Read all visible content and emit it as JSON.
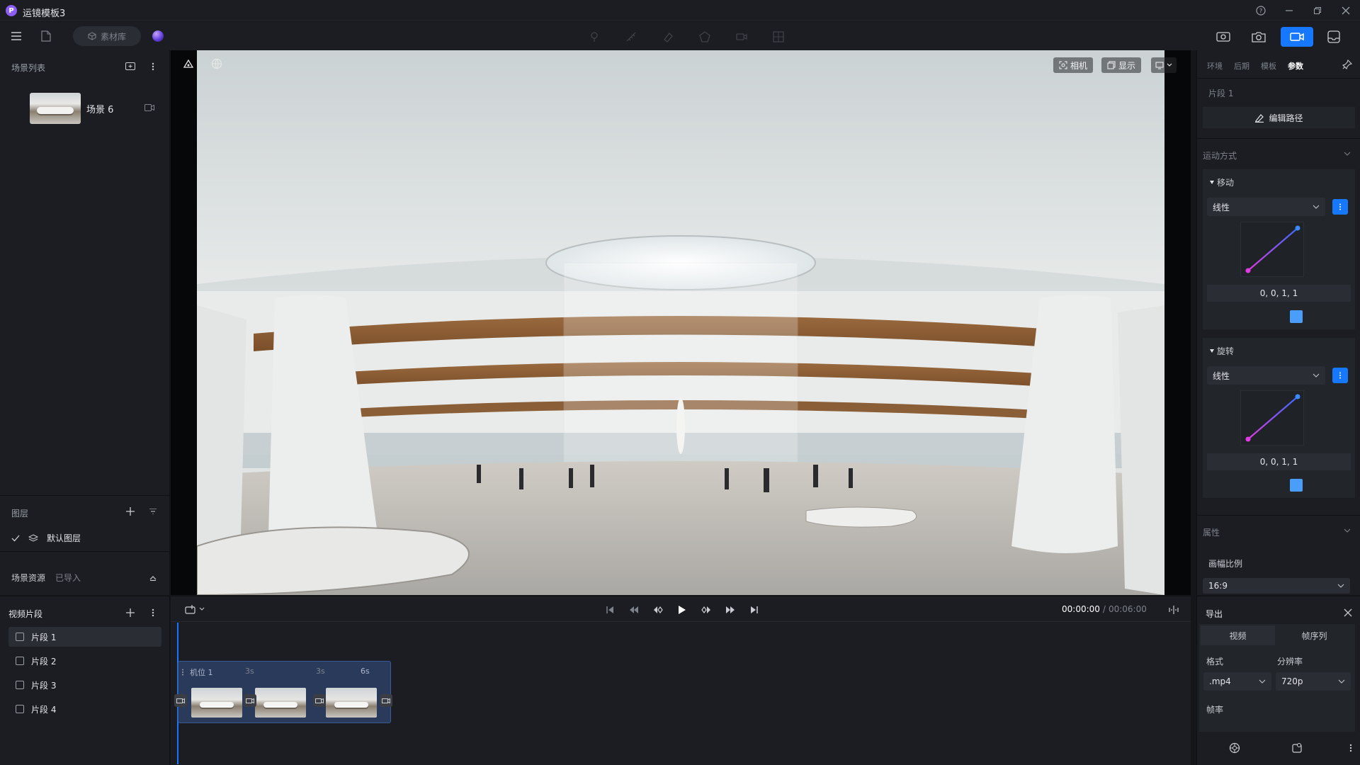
{
  "window": {
    "title": "运镜模板3",
    "logo_letter": "P",
    "controls": [
      "help-icon",
      "minimize-icon",
      "restore-icon",
      "close-icon"
    ]
  },
  "toolbar": {
    "material_library": "素材库",
    "right_tools": [
      "panorama-icon",
      "photo-icon",
      "video-camera-icon",
      "output-icon"
    ],
    "accent": "#1677ff"
  },
  "scene_list": {
    "title": "场景列表",
    "items": [
      {
        "name": "场景 6"
      }
    ]
  },
  "layers": {
    "title": "图层",
    "items": [
      {
        "name": "默认图层"
      }
    ]
  },
  "scene_assets": {
    "title": "场景资源",
    "status": "已导入"
  },
  "viewport": {
    "camera_label": "相机",
    "display_label": "显示"
  },
  "right_panel": {
    "tabs": [
      "环境",
      "后期",
      "模板",
      "参数"
    ],
    "active_tab": "参数",
    "segment_title": "片段 1",
    "edit_path": "编辑路径",
    "motion_mode": "运动方式",
    "move": {
      "title": "移动",
      "curve": "线性",
      "value": "0, 0, 1, 1"
    },
    "rotate": {
      "title": "旋转",
      "curve": "线性",
      "value": "0, 0, 1, 1"
    },
    "attributes": "属性",
    "aspect_label": "画幅比例",
    "aspect_value": "16:9"
  },
  "clips": {
    "title": "视频片段",
    "items": [
      "片段 1",
      "片段 2",
      "片段 3",
      "片段 4"
    ],
    "active_index": 0
  },
  "timeline": {
    "current_time": "00:00:00",
    "separator": "/",
    "total_time": "00:06:00",
    "track_name": "机位 1",
    "marks": [
      "3s",
      "3s",
      "6s"
    ]
  },
  "export": {
    "title": "导出",
    "tabs": [
      "视频",
      "帧序列"
    ],
    "format_label": "格式",
    "format_value": ".mp4",
    "resolution_label": "分辨率",
    "resolution_value": "720p",
    "framerate_label": "帧率"
  }
}
